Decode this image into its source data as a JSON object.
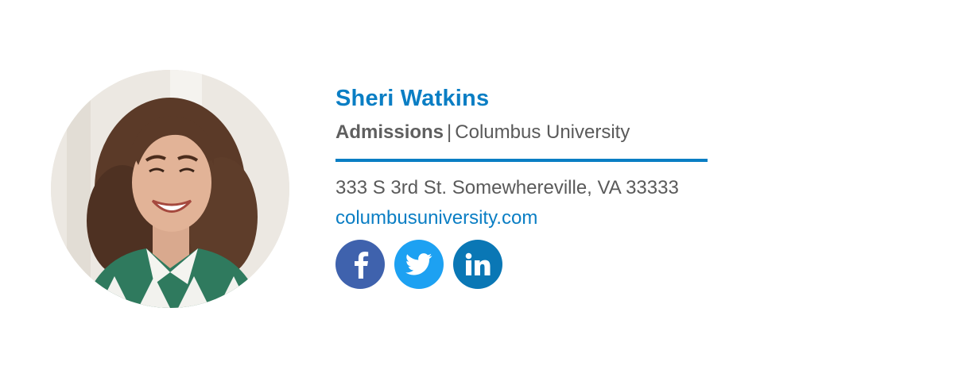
{
  "colors": {
    "accent": "#0a7ec4",
    "facebook": "#3f62ad",
    "twitter": "#1da1f2",
    "linkedin": "#0a77b5",
    "text": "#5a5a5a"
  },
  "profile": {
    "photo_icon": "profile-photo"
  },
  "contact": {
    "name": "Sheri Watkins",
    "department": "Admissions",
    "separator": "|",
    "organization": "Columbus University",
    "address": "333 S 3rd St. Somewhereville, VA 33333",
    "website": "columbusuniversity.com"
  },
  "social": [
    {
      "icon": "facebook-icon"
    },
    {
      "icon": "twitter-icon"
    },
    {
      "icon": "linkedin-icon"
    }
  ]
}
